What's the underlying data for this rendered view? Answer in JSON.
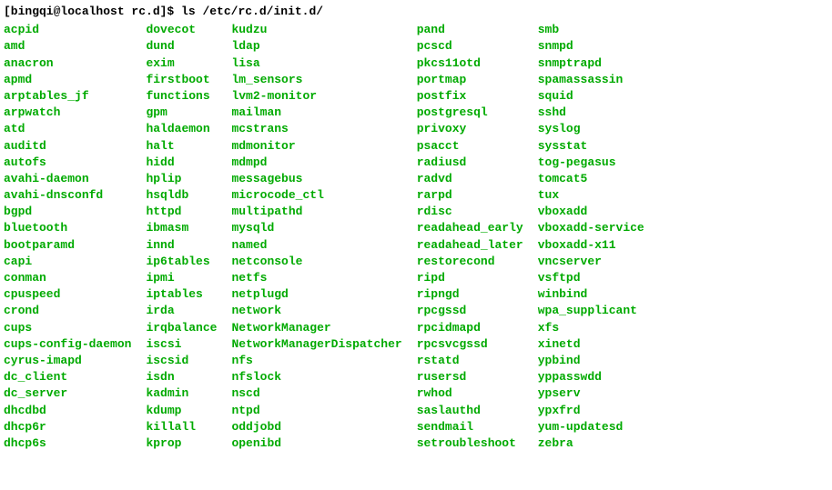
{
  "prompt": {
    "user_host": "[bingqi@localhost rc.d]$",
    "command": "ls /etc/rc.d/init.d/"
  },
  "columns": [
    [
      "acpid",
      "amd",
      "anacron",
      "apmd",
      "arptables_jf",
      "arpwatch",
      "atd",
      "auditd",
      "autofs",
      "avahi-daemon",
      "avahi-dnsconfd",
      "bgpd",
      "bluetooth",
      "bootparamd",
      "capi",
      "conman",
      "cpuspeed",
      "crond",
      "cups",
      "cups-config-daemon",
      "cyrus-imapd",
      "dc_client",
      "dc_server",
      "dhcdbd",
      "dhcp6r",
      "dhcp6s"
    ],
    [
      "dovecot",
      "dund",
      "exim",
      "firstboot",
      "functions",
      "gpm",
      "haldaemon",
      "halt",
      "hidd",
      "hplip",
      "hsqldb",
      "httpd",
      "ibmasm",
      "innd",
      "ip6tables",
      "ipmi",
      "iptables",
      "irda",
      "irqbalance",
      "iscsi",
      "iscsid",
      "isdn",
      "kadmin",
      "kdump",
      "killall",
      "kprop"
    ],
    [
      "kudzu",
      "ldap",
      "lisa",
      "lm_sensors",
      "lvm2-monitor",
      "mailman",
      "mcstrans",
      "mdmonitor",
      "mdmpd",
      "messagebus",
      "microcode_ctl",
      "multipathd",
      "mysqld",
      "named",
      "netconsole",
      "netfs",
      "netplugd",
      "network",
      "NetworkManager",
      "NetworkManagerDispatcher",
      "nfs",
      "nfslock",
      "nscd",
      "ntpd",
      "oddjobd",
      "openibd"
    ],
    [
      "pand",
      "pcscd",
      "pkcs11otd",
      "portmap",
      "postfix",
      "postgresql",
      "privoxy",
      "psacct",
      "radiusd",
      "radvd",
      "rarpd",
      "rdisc",
      "readahead_early",
      "readahead_later",
      "restorecond",
      "ripd",
      "ripngd",
      "rpcgssd",
      "rpcidmapd",
      "rpcsvcgssd",
      "rstatd",
      "rusersd",
      "rwhod",
      "saslauthd",
      "sendmail",
      "setroubleshoot"
    ],
    [
      "smb",
      "snmpd",
      "snmptrapd",
      "spamassassin",
      "squid",
      "sshd",
      "syslog",
      "sysstat",
      "tog-pegasus",
      "tomcat5",
      "tux",
      "vboxadd",
      "vboxadd-service",
      "vboxadd-x11",
      "vncserver",
      "vsftpd",
      "winbind",
      "wpa_supplicant",
      "xfs",
      "xinetd",
      "ypbind",
      "yppasswdd",
      "ypserv",
      "ypxfrd",
      "yum-updatesd",
      "zebra"
    ]
  ]
}
